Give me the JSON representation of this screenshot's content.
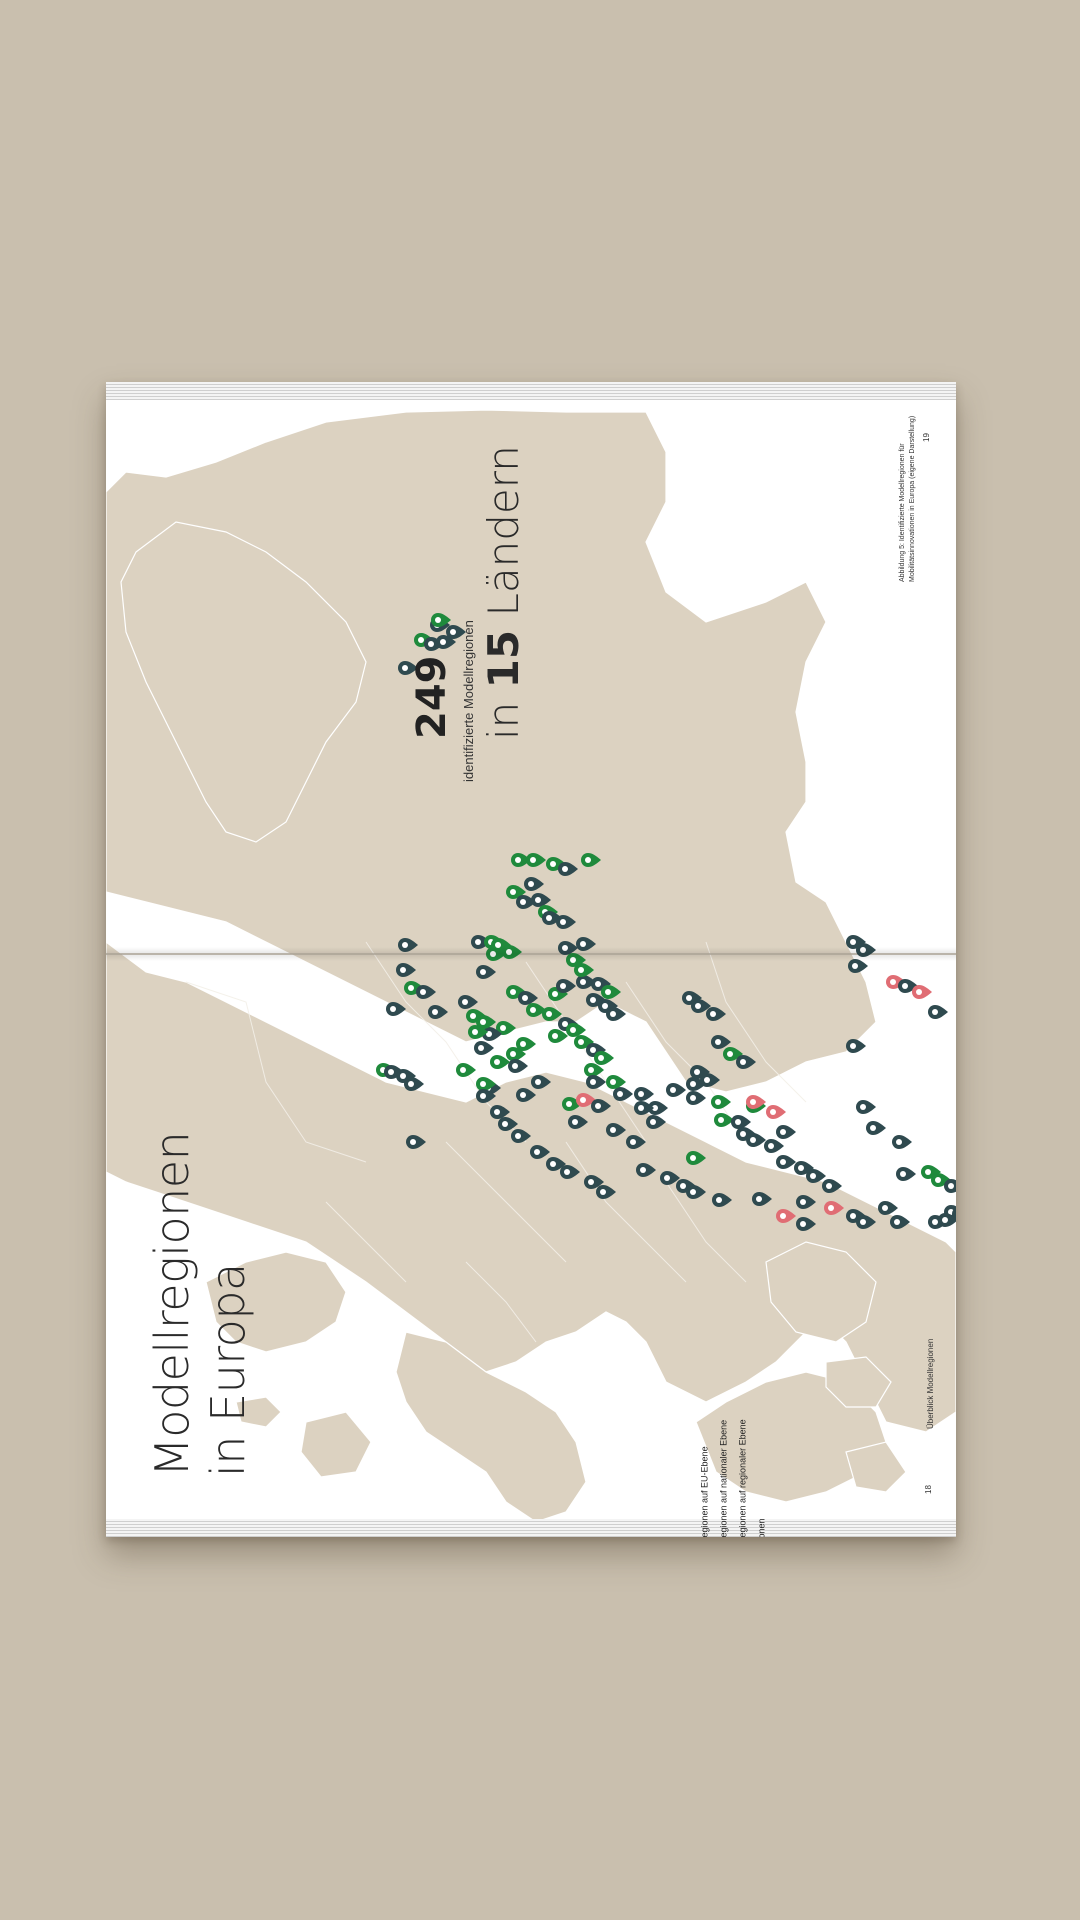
{
  "title": {
    "line1": "Modellregionen",
    "line2": "in Europa"
  },
  "stats": {
    "count": "249",
    "count_sub": "identifizierte Modellregionen",
    "countries_prefix": "in ",
    "countries_number": "15",
    "countries_suffix": " Ländern"
  },
  "caption": {
    "line1": "Abbildung 5: Identifizierte Modellregionen für",
    "line2": "Mobilitätsinnovationen in Europa (eigene Darstellung)"
  },
  "folio_right": "19",
  "folio_left": "18",
  "footer_left": "Überblick Modellregionen",
  "legend": {
    "items": [
      {
        "label": "Modellregionen auf EU-Ebene",
        "color": "#2f4a4f"
      },
      {
        "label": "Modellregionen auf nationaler Ebene",
        "color": "#e06d74"
      },
      {
        "label": "Modellregionen auf regionaler Ebene",
        "color": "#1f8a3c"
      },
      {
        "label": "Teilregionen",
        "color": "#2f4a4f"
      }
    ]
  },
  "colors": {
    "background": "#c9bfae",
    "land": "#dcd2c1",
    "sea": "#ffffff",
    "eu_marker": "#2f4a4f",
    "national_marker": "#e06d74",
    "regional_marker": "#1f8a3c"
  }
}
